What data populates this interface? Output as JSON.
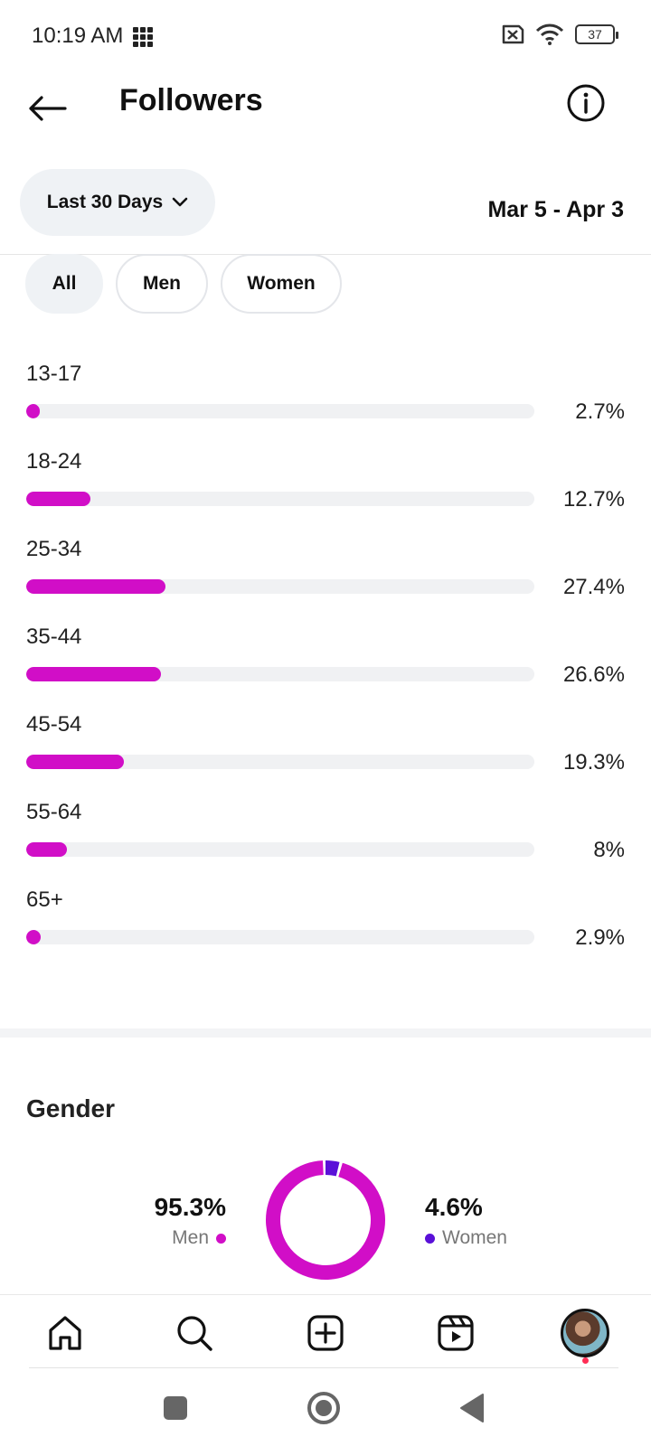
{
  "status_bar": {
    "time": "10:19 AM",
    "battery": "37"
  },
  "header": {
    "title": "Followers"
  },
  "range": {
    "label": "Last 30 Days",
    "dates": "Mar 5 - Apr 3"
  },
  "filters": [
    "All",
    "Men",
    "Women"
  ],
  "chart_data": {
    "type": "bar",
    "categories": [
      "13-17",
      "18-24",
      "25-34",
      "35-44",
      "45-54",
      "55-64",
      "65+"
    ],
    "values": [
      2.7,
      12.7,
      27.4,
      26.6,
      19.3,
      8,
      2.9
    ],
    "value_labels": [
      "2.7%",
      "12.7%",
      "27.4%",
      "26.6%",
      "19.3%",
      "8%",
      "2.9%"
    ],
    "ylim": [
      0,
      100
    ],
    "color": "#d10ec7"
  },
  "gender": {
    "title": "Gender",
    "men_pct": "95.3%",
    "men_label": "Men",
    "women_pct": "4.6%",
    "women_label": "Women",
    "men_value": 95.3,
    "women_value": 4.6,
    "men_color": "#d10ec7",
    "women_color": "#5a10d8"
  },
  "nav": {
    "items": [
      "home-icon",
      "search-icon",
      "create-icon",
      "reels-icon",
      "profile-avatar"
    ]
  }
}
